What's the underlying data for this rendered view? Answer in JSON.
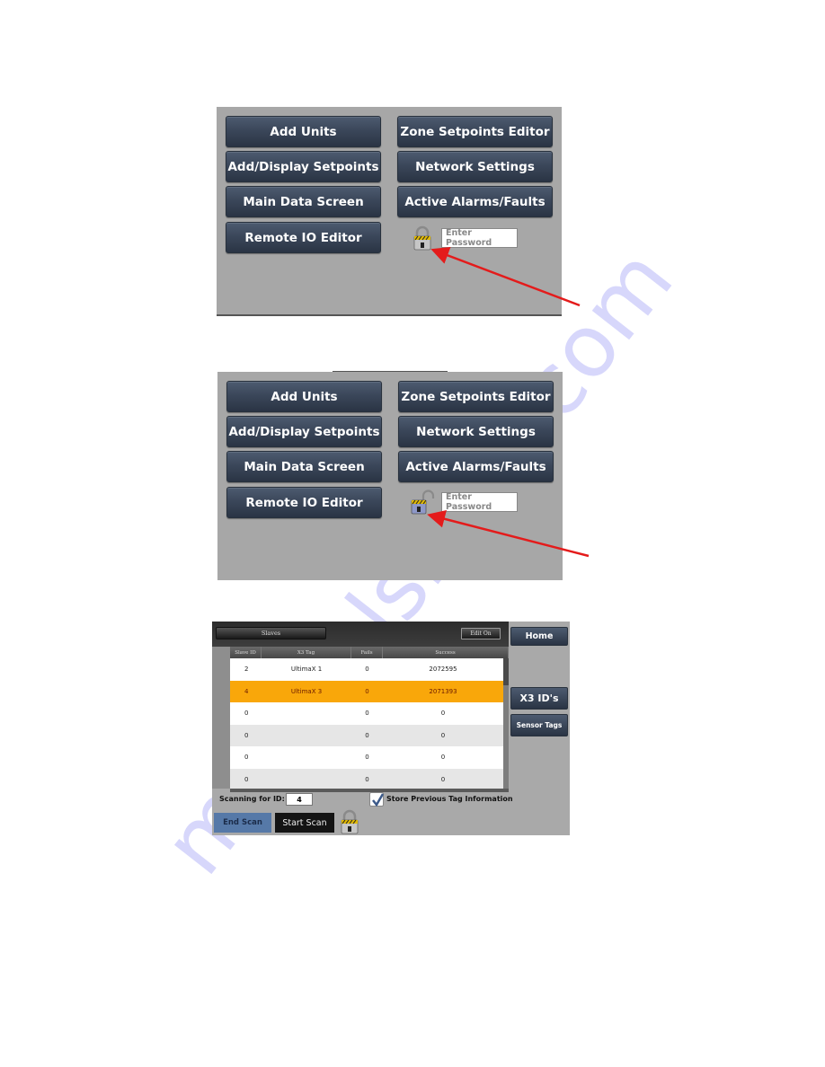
{
  "screens": [
    {
      "buttons_left": [
        "Add Units",
        "Add/Display Setpoints",
        "Main Data Screen",
        "Remote IO Editor"
      ],
      "buttons_right": [
        "Zone Setpoints Editor",
        "Network Settings",
        "Active Alarms/Faults"
      ],
      "lock_state": "locked",
      "password_placeholder": "Enter Password"
    },
    {
      "buttons_left": [
        "Add Units",
        "Add/Display Setpoints",
        "Main Data Screen",
        "Remote IO Editor"
      ],
      "buttons_right": [
        "Zone Setpoints Editor",
        "Network Settings",
        "Active Alarms/Faults"
      ],
      "lock_state": "unlocked",
      "password_placeholder": "Enter Password"
    }
  ],
  "scan_screen": {
    "slaves_button": "Slaves",
    "edit_button": "Edit On",
    "columns": [
      "Slave ID",
      "X3 Tag",
      "Fails",
      "Success"
    ],
    "rows": [
      {
        "id": "2",
        "tag": "UltimaX 1",
        "fails": "0",
        "success": "2072595",
        "selected": false
      },
      {
        "id": "4",
        "tag": "UltimaX 3",
        "fails": "0",
        "success": "2071393",
        "selected": true
      },
      {
        "id": "0",
        "tag": "",
        "fails": "0",
        "success": "0",
        "selected": false
      },
      {
        "id": "0",
        "tag": "",
        "fails": "0",
        "success": "0",
        "selected": false
      },
      {
        "id": "0",
        "tag": "",
        "fails": "0",
        "success": "0",
        "selected": false
      },
      {
        "id": "0",
        "tag": "",
        "fails": "0",
        "success": "0",
        "selected": false
      }
    ],
    "side_buttons": {
      "home": "Home",
      "x3_ids": "X3 ID's",
      "sensor_tags": "Sensor Tags"
    },
    "scanning_label": "Scanning for ID:",
    "scanning_id": "4",
    "store_checkbox_label": "Store Previous Tag Information",
    "store_checked": true,
    "end_scan": "End Scan",
    "start_scan": "Start Scan",
    "lock_state": "locked"
  },
  "colors": {
    "arrow": "#e41b1b",
    "selected_row": "#f9a70a",
    "button": "#3b475a"
  },
  "watermark": "manualshive.com"
}
